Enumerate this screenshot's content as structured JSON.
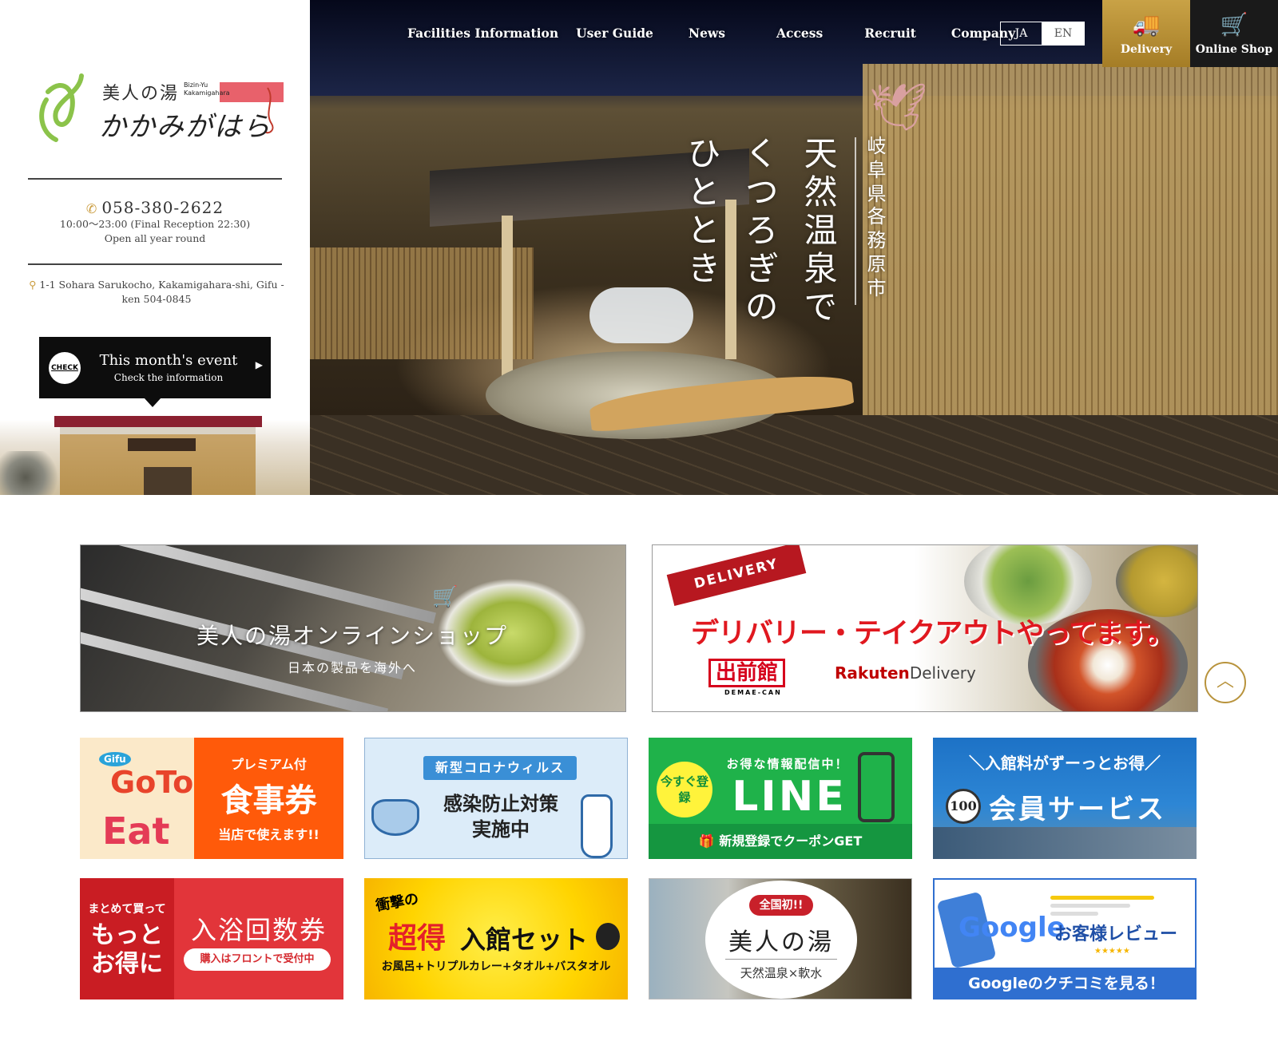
{
  "brand": {
    "logo_jp_top": "美人の湯",
    "logo_en_1": "Bizin-Yu",
    "logo_en_2": "Kakamigahara",
    "logo_jp_main": "かかみがはら",
    "logo_glyph": "ゆ",
    "accent_gold": "#c99a3a",
    "accent_red": "#e0181f"
  },
  "contact": {
    "phone": "058-380-2622",
    "hours": "10:00～23:00 (Final Reception 22:30)",
    "open": "Open all year round",
    "address": "1-1 Sohara Sarukocho, Kakamigahara-shi, Gifu -ken 504-0845"
  },
  "event": {
    "badge": "CHECK",
    "title": "This month's event",
    "subtitle": "Check the information",
    "arrow": "▶"
  },
  "nav": {
    "items": [
      "Facilities Information",
      "User Guide",
      "News",
      "Access",
      "Recruit",
      "Company"
    ],
    "lang": [
      "JA",
      "EN"
    ],
    "delivery_label": "Delivery",
    "shop_label": "Online Shop"
  },
  "hero": {
    "line_main_1": "天然温泉で",
    "line_main_2": "くつろぎの",
    "line_main_3": "ひととき",
    "line_loc_1": "岐阜県",
    "line_loc_2": "各務原市"
  },
  "banners": {
    "shop": {
      "title": "美人の湯オンラインショップ",
      "sub": "日本の製品を海外へ"
    },
    "delivery": {
      "ribbon": "DELIVERY",
      "head": "デリバリー・テイクアウトやってます。",
      "demae": "出前館",
      "demae_sub": "DEMAE-CAN",
      "rakuten_1": "Rakuten",
      "rakuten_2": "Delivery"
    },
    "goto": {
      "gifu": "Gifu",
      "go": "GoTo",
      "eat": "Eat",
      "p1": "プレミアム付",
      "p2": "食事券",
      "p3": "当店で使えます!!"
    },
    "corona": {
      "tag": "新型コロナウィルス",
      "l1": "感染防止対策",
      "l2": "実施中"
    },
    "line": {
      "now": "今すぐ登録",
      "info": "お得な情報配信中！",
      "line": "LINE",
      "bar": "新規登録でクーポンGET"
    },
    "member": {
      "tl": "＼入館料がずーっとお得／",
      "badge": "100",
      "svc": "会員サービス"
    },
    "ticket": {
      "s1": "まとめて買って",
      "s2a": "もっと",
      "s2b": "お得に",
      "big": "入浴回数券",
      "pill": "購入はフロントで受付中"
    },
    "set": {
      "shock": "衝撃の",
      "tok": "超得",
      "nk": "入館セット",
      "items": "お風呂+トリプルカレー+タオル+バスタオル"
    },
    "bijin": {
      "first": "全国初!!",
      "name": "美人の湯",
      "line2": "天然温泉×軟水"
    },
    "google": {
      "g": "Google",
      "rv": "お客様レビュー",
      "stars": "★★★★★",
      "foot": "Googleのクチコミを見る！"
    }
  },
  "scroll_top": "︿"
}
